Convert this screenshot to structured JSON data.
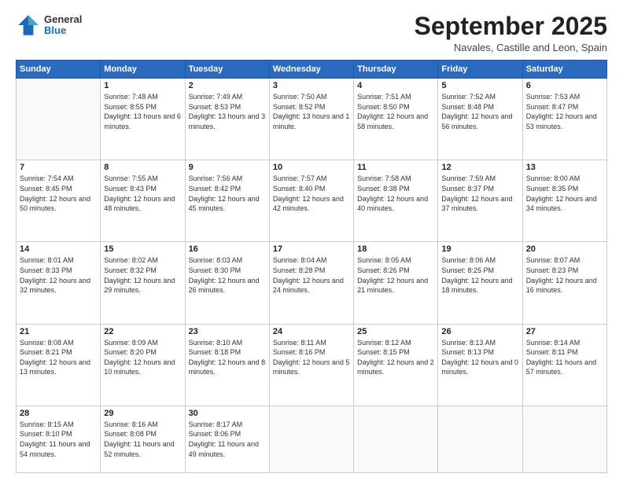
{
  "logo": {
    "general": "General",
    "blue": "Blue"
  },
  "title": "September 2025",
  "location": "Navales, Castille and Leon, Spain",
  "days_header": [
    "Sunday",
    "Monday",
    "Tuesday",
    "Wednesday",
    "Thursday",
    "Friday",
    "Saturday"
  ],
  "weeks": [
    [
      {
        "day": "",
        "sunrise": "",
        "sunset": "",
        "daylight": ""
      },
      {
        "day": "1",
        "sunrise": "Sunrise: 7:48 AM",
        "sunset": "Sunset: 8:55 PM",
        "daylight": "Daylight: 13 hours and 6 minutes."
      },
      {
        "day": "2",
        "sunrise": "Sunrise: 7:49 AM",
        "sunset": "Sunset: 8:53 PM",
        "daylight": "Daylight: 13 hours and 3 minutes."
      },
      {
        "day": "3",
        "sunrise": "Sunrise: 7:50 AM",
        "sunset": "Sunset: 8:52 PM",
        "daylight": "Daylight: 13 hours and 1 minute."
      },
      {
        "day": "4",
        "sunrise": "Sunrise: 7:51 AM",
        "sunset": "Sunset: 8:50 PM",
        "daylight": "Daylight: 12 hours and 58 minutes."
      },
      {
        "day": "5",
        "sunrise": "Sunrise: 7:52 AM",
        "sunset": "Sunset: 8:48 PM",
        "daylight": "Daylight: 12 hours and 56 minutes."
      },
      {
        "day": "6",
        "sunrise": "Sunrise: 7:53 AM",
        "sunset": "Sunset: 8:47 PM",
        "daylight": "Daylight: 12 hours and 53 minutes."
      }
    ],
    [
      {
        "day": "7",
        "sunrise": "Sunrise: 7:54 AM",
        "sunset": "Sunset: 8:45 PM",
        "daylight": "Daylight: 12 hours and 50 minutes."
      },
      {
        "day": "8",
        "sunrise": "Sunrise: 7:55 AM",
        "sunset": "Sunset: 8:43 PM",
        "daylight": "Daylight: 12 hours and 48 minutes."
      },
      {
        "day": "9",
        "sunrise": "Sunrise: 7:56 AM",
        "sunset": "Sunset: 8:42 PM",
        "daylight": "Daylight: 12 hours and 45 minutes."
      },
      {
        "day": "10",
        "sunrise": "Sunrise: 7:57 AM",
        "sunset": "Sunset: 8:40 PM",
        "daylight": "Daylight: 12 hours and 42 minutes."
      },
      {
        "day": "11",
        "sunrise": "Sunrise: 7:58 AM",
        "sunset": "Sunset: 8:38 PM",
        "daylight": "Daylight: 12 hours and 40 minutes."
      },
      {
        "day": "12",
        "sunrise": "Sunrise: 7:59 AM",
        "sunset": "Sunset: 8:37 PM",
        "daylight": "Daylight: 12 hours and 37 minutes."
      },
      {
        "day": "13",
        "sunrise": "Sunrise: 8:00 AM",
        "sunset": "Sunset: 8:35 PM",
        "daylight": "Daylight: 12 hours and 34 minutes."
      }
    ],
    [
      {
        "day": "14",
        "sunrise": "Sunrise: 8:01 AM",
        "sunset": "Sunset: 8:33 PM",
        "daylight": "Daylight: 12 hours and 32 minutes."
      },
      {
        "day": "15",
        "sunrise": "Sunrise: 8:02 AM",
        "sunset": "Sunset: 8:32 PM",
        "daylight": "Daylight: 12 hours and 29 minutes."
      },
      {
        "day": "16",
        "sunrise": "Sunrise: 8:03 AM",
        "sunset": "Sunset: 8:30 PM",
        "daylight": "Daylight: 12 hours and 26 minutes."
      },
      {
        "day": "17",
        "sunrise": "Sunrise: 8:04 AM",
        "sunset": "Sunset: 8:28 PM",
        "daylight": "Daylight: 12 hours and 24 minutes."
      },
      {
        "day": "18",
        "sunrise": "Sunrise: 8:05 AM",
        "sunset": "Sunset: 8:26 PM",
        "daylight": "Daylight: 12 hours and 21 minutes."
      },
      {
        "day": "19",
        "sunrise": "Sunrise: 8:06 AM",
        "sunset": "Sunset: 8:25 PM",
        "daylight": "Daylight: 12 hours and 18 minutes."
      },
      {
        "day": "20",
        "sunrise": "Sunrise: 8:07 AM",
        "sunset": "Sunset: 8:23 PM",
        "daylight": "Daylight: 12 hours and 16 minutes."
      }
    ],
    [
      {
        "day": "21",
        "sunrise": "Sunrise: 8:08 AM",
        "sunset": "Sunset: 8:21 PM",
        "daylight": "Daylight: 12 hours and 13 minutes."
      },
      {
        "day": "22",
        "sunrise": "Sunrise: 8:09 AM",
        "sunset": "Sunset: 8:20 PM",
        "daylight": "Daylight: 12 hours and 10 minutes."
      },
      {
        "day": "23",
        "sunrise": "Sunrise: 8:10 AM",
        "sunset": "Sunset: 8:18 PM",
        "daylight": "Daylight: 12 hours and 8 minutes."
      },
      {
        "day": "24",
        "sunrise": "Sunrise: 8:11 AM",
        "sunset": "Sunset: 8:16 PM",
        "daylight": "Daylight: 12 hours and 5 minutes."
      },
      {
        "day": "25",
        "sunrise": "Sunrise: 8:12 AM",
        "sunset": "Sunset: 8:15 PM",
        "daylight": "Daylight: 12 hours and 2 minutes."
      },
      {
        "day": "26",
        "sunrise": "Sunrise: 8:13 AM",
        "sunset": "Sunset: 8:13 PM",
        "daylight": "Daylight: 12 hours and 0 minutes."
      },
      {
        "day": "27",
        "sunrise": "Sunrise: 8:14 AM",
        "sunset": "Sunset: 8:11 PM",
        "daylight": "Daylight: 11 hours and 57 minutes."
      }
    ],
    [
      {
        "day": "28",
        "sunrise": "Sunrise: 8:15 AM",
        "sunset": "Sunset: 8:10 PM",
        "daylight": "Daylight: 11 hours and 54 minutes."
      },
      {
        "day": "29",
        "sunrise": "Sunrise: 8:16 AM",
        "sunset": "Sunset: 8:08 PM",
        "daylight": "Daylight: 11 hours and 52 minutes."
      },
      {
        "day": "30",
        "sunrise": "Sunrise: 8:17 AM",
        "sunset": "Sunset: 8:06 PM",
        "daylight": "Daylight: 11 hours and 49 minutes."
      },
      {
        "day": "",
        "sunrise": "",
        "sunset": "",
        "daylight": ""
      },
      {
        "day": "",
        "sunrise": "",
        "sunset": "",
        "daylight": ""
      },
      {
        "day": "",
        "sunrise": "",
        "sunset": "",
        "daylight": ""
      },
      {
        "day": "",
        "sunrise": "",
        "sunset": "",
        "daylight": ""
      }
    ]
  ]
}
